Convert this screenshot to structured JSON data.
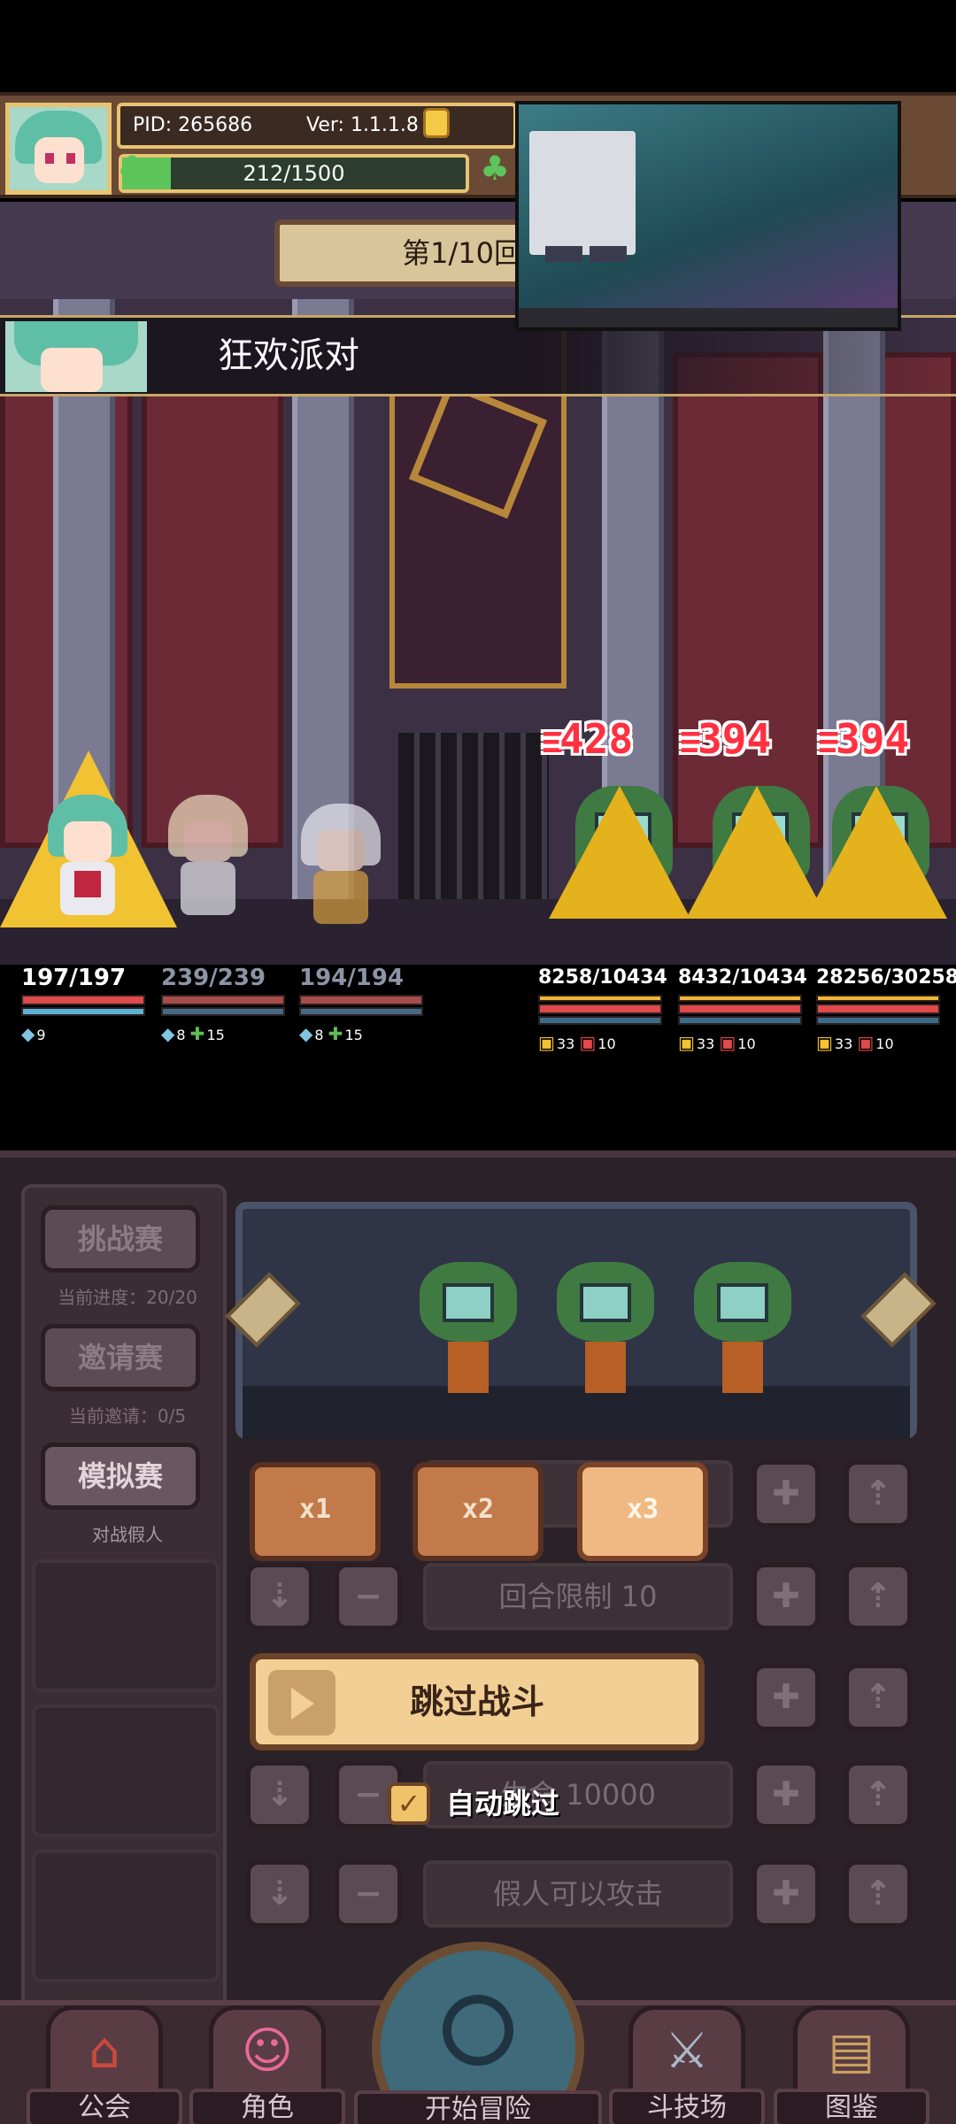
{
  "header": {
    "pid": "PID: 265686",
    "version": "Ver: 1.1.1.8",
    "energy": {
      "text": "212/1500",
      "current": 212,
      "max": 1500
    }
  },
  "battle": {
    "round": "第1/10回",
    "skill_name": "狂欢派对",
    "damage": [
      "428",
      "394",
      "394"
    ],
    "allies": [
      {
        "hp": "197/197",
        "buffs": [
          "9"
        ]
      },
      {
        "hp": "239/239",
        "buffs": [
          "8",
          "15"
        ]
      },
      {
        "hp": "194/194",
        "buffs": [
          "8",
          "15"
        ]
      }
    ],
    "enemies": [
      {
        "hp": "8258/10434",
        "buffs": [
          "33",
          "10"
        ]
      },
      {
        "hp": "8432/10434",
        "buffs": [
          "33",
          "10"
        ]
      },
      {
        "hp": "28256/30258",
        "buffs": [
          "33",
          "10"
        ]
      }
    ]
  },
  "sidebar": {
    "challenge": "挑战赛",
    "challenge_progress": "当前进度：20/20",
    "invite": "邀请赛",
    "invite_count": "当前邀请：0/5",
    "mock": "模拟赛",
    "mock_caption": "对战假人"
  },
  "settings": {
    "speed": [
      "x1",
      "x2",
      "x3"
    ],
    "round_limit": "回合限制 10",
    "hp_field": "生命 10000",
    "dummy_attack": "假人可以攻击",
    "skip_battle": "跳过战斗",
    "auto_skip": "自动跳过",
    "auto_skip_checked": true
  },
  "nav": {
    "guild": "公会",
    "character": "角色",
    "adventure": "开始冒险",
    "arena": "斗技场",
    "codex": "图鉴"
  },
  "colors": {
    "accent_gold": "#e8c372",
    "hp_red": "#e04a4a",
    "mp_blue": "#5fb3d4",
    "damage_red": "#ff3040",
    "button_orange": "#f0b984"
  },
  "icons": {
    "avatar": "character-portrait",
    "coin": "coin-icon",
    "clover": "clover-icon",
    "plus": "plus-icon",
    "minus": "minus-icon",
    "download": "download-icon",
    "upload": "upload-icon"
  }
}
